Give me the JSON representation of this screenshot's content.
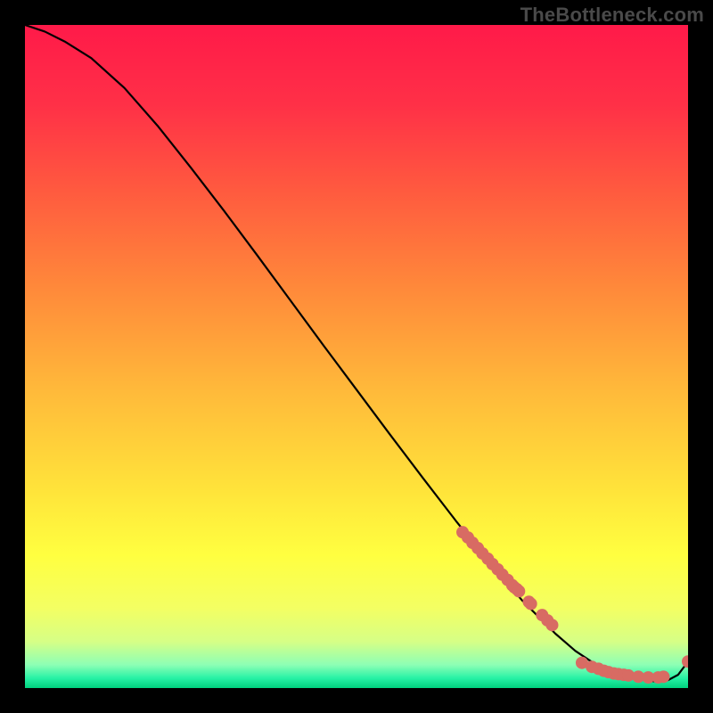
{
  "watermark": "TheBottleneck.com",
  "colors": {
    "gradient_stops": [
      {
        "offset": 0.0,
        "color": "#ff1a49"
      },
      {
        "offset": 0.12,
        "color": "#ff3047"
      },
      {
        "offset": 0.25,
        "color": "#ff5a3f"
      },
      {
        "offset": 0.4,
        "color": "#ff8a3a"
      },
      {
        "offset": 0.55,
        "color": "#ffb93a"
      },
      {
        "offset": 0.7,
        "color": "#ffe33a"
      },
      {
        "offset": 0.8,
        "color": "#ffff40"
      },
      {
        "offset": 0.88,
        "color": "#f3ff63"
      },
      {
        "offset": 0.93,
        "color": "#d6ff86"
      },
      {
        "offset": 0.965,
        "color": "#8dffb5"
      },
      {
        "offset": 0.985,
        "color": "#27f2a6"
      },
      {
        "offset": 1.0,
        "color": "#00d17e"
      }
    ],
    "curve": "#000000",
    "dot": "#d86b63",
    "frame": "#000000"
  },
  "chart_data": {
    "type": "line",
    "title": "",
    "xlabel": "",
    "ylabel": "",
    "xlim": [
      0,
      100
    ],
    "ylim": [
      0,
      100
    ],
    "grid": false,
    "legend": false,
    "series": [
      {
        "name": "bottleneck-curve",
        "style": "line",
        "x": [
          0,
          3,
          6,
          10,
          15,
          20,
          25,
          30,
          35,
          40,
          45,
          50,
          55,
          60,
          65,
          70,
          75,
          80,
          83,
          86,
          89,
          92,
          95,
          97,
          98.5,
          100
        ],
        "values": [
          100,
          99,
          97.5,
          95,
          90.5,
          84.8,
          78.5,
          72,
          65.3,
          58.5,
          51.7,
          45,
          38.3,
          31.7,
          25.2,
          19,
          13.2,
          8.2,
          5.6,
          3.6,
          2.2,
          1.4,
          1.0,
          1.2,
          2.0,
          4.0
        ]
      },
      {
        "name": "highlight-dots-descending",
        "style": "points",
        "x": [
          66,
          66.8,
          67.5,
          68.3,
          69,
          69.8,
          70.5,
          71.3,
          72,
          72.8,
          73.5,
          73.8,
          74.2,
          74.5,
          76,
          76.3,
          78,
          78.8,
          79.5
        ],
        "values": [
          23.5,
          22.7,
          21.9,
          21.1,
          20.3,
          19.5,
          18.7,
          17.9,
          17.1,
          16.3,
          15.5,
          15.2,
          14.9,
          14.6,
          13,
          12.7,
          11.0,
          10.2,
          9.5
        ]
      },
      {
        "name": "highlight-dots-trough",
        "style": "points",
        "x": [
          84,
          85.5,
          86.5,
          87.3,
          88,
          88.8,
          89.5,
          90.3,
          91,
          92.5,
          94,
          95.5,
          96.3,
          100
        ],
        "values": [
          3.8,
          3.2,
          2.9,
          2.6,
          2.4,
          2.2,
          2.1,
          2.0,
          1.9,
          1.7,
          1.6,
          1.6,
          1.7,
          4.0
        ]
      }
    ]
  }
}
